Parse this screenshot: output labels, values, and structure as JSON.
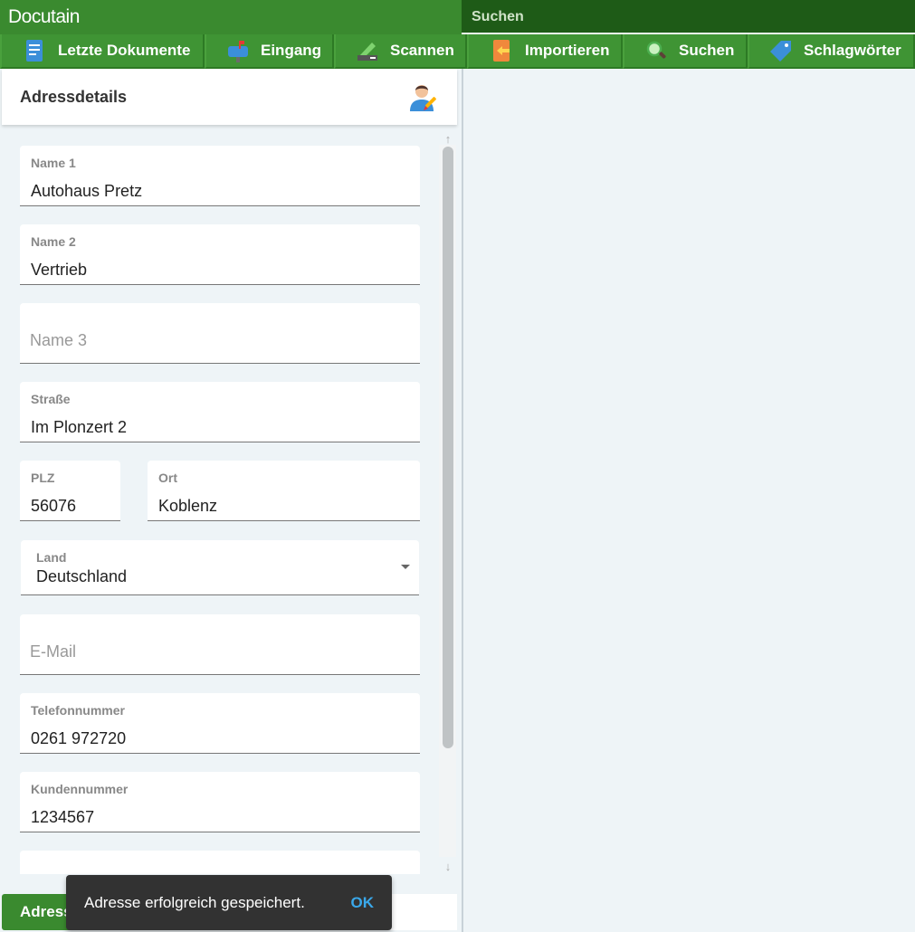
{
  "app": {
    "logo_text": "Docutain",
    "search_title": "Suchen"
  },
  "toolbar": {
    "items": [
      {
        "label": "Letzte Dokumente",
        "icon": "document-icon"
      },
      {
        "label": "Eingang",
        "icon": "mailbox-icon"
      },
      {
        "label": "Scannen",
        "icon": "scanner-icon"
      },
      {
        "label": "Importieren",
        "icon": "import-icon"
      },
      {
        "label": "Suchen",
        "icon": "search-icon"
      },
      {
        "label": "Schlagwörter",
        "icon": "tag-icon"
      }
    ]
  },
  "panel": {
    "title": "Adressdetails",
    "header_icon": "person-edit-icon"
  },
  "form": {
    "name1": {
      "label": "Name 1",
      "value": "Autohaus Pretz"
    },
    "name2": {
      "label": "Name 2",
      "value": "Vertrieb"
    },
    "name3": {
      "placeholder": "Name 3"
    },
    "street": {
      "label": "Straße",
      "value": "Im Plonzert 2"
    },
    "zip": {
      "label": "PLZ",
      "value": "56076"
    },
    "city": {
      "label": "Ort",
      "value": "Koblenz"
    },
    "country": {
      "label": "Land",
      "value": "Deutschland"
    },
    "email": {
      "placeholder": "E-Mail"
    },
    "phone": {
      "label": "Telefonnummer",
      "value": "0261 972720"
    },
    "customer_no": {
      "label": "Kundennummer",
      "value": "1234567"
    }
  },
  "bottom": {
    "button_label": "Adress"
  },
  "snackbar": {
    "message": "Adresse erfolgreich gespeichert.",
    "action": "OK"
  },
  "colors": {
    "brand_green": "#3a8a2f",
    "dark_green": "#1e5b17",
    "snackbar_bg": "#323232",
    "snackbar_action": "#3aa8ea"
  }
}
